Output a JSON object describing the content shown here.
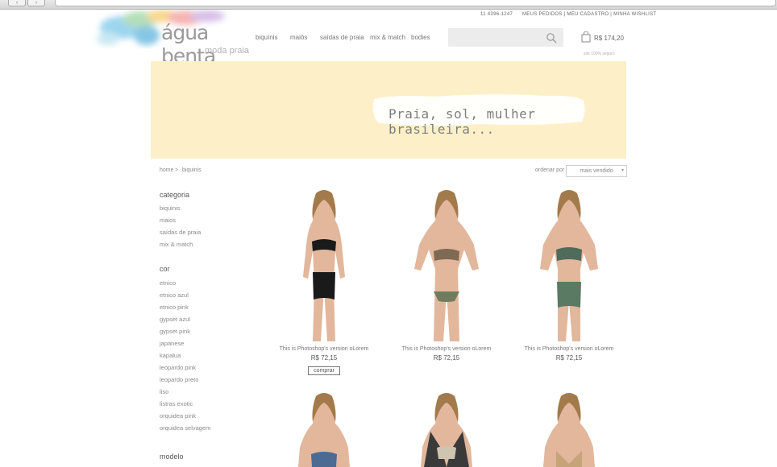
{
  "browser": {
    "back_icon": "chevron-left-icon",
    "forward_icon": "chevron-right-icon"
  },
  "header": {
    "logo_title": "água benta",
    "logo_subtitle": "moda praia",
    "phone": "11 4396-1247",
    "account_links": "MEUS PEDIDOS | MEU CADASTRO | MINHA WISHLIST",
    "menu": [
      "biquínis",
      "maiôs",
      "saídas de praia",
      "mix & match",
      "bodies"
    ],
    "search_placeholder": "",
    "cart_total": "R$ 174,20",
    "secure_note": "site 100% seguro"
  },
  "banner": {
    "text": "Praia, sol, mulher brasileira..."
  },
  "breadcrumb": {
    "home": "home",
    "separator": ">",
    "current": "biquinis"
  },
  "sort": {
    "label": "ordenar por",
    "selected": "mais vendido"
  },
  "sidebar": {
    "categoria_title": "categoria",
    "categoria_items": [
      "biquinis",
      "maios",
      "saídas de praia",
      "mix & match"
    ],
    "cor_title": "cor",
    "cor_items": [
      "etnico",
      "etnico azul",
      "etnico pink",
      "gypset azul",
      "gypset pink",
      "japanese",
      "kapalua",
      "leopardo pink",
      "leopardo preto",
      "liso",
      "listras exotic",
      "orquidea pink",
      "orquidea selvagem"
    ],
    "modelo_title": "modelo"
  },
  "products": [
    {
      "name": "This is Photoshop's version  oLorem",
      "price": "R$ 72,15",
      "buy_label": "comprar"
    },
    {
      "name": "This is Photoshop's version  oLorem",
      "price": "R$ 72,15"
    },
    {
      "name": "This is Photoshop's version  oLorem",
      "price": "R$ 72,15"
    }
  ],
  "colors": {
    "banner_bg": "#fdf0c9",
    "search_bg": "#ececec",
    "text": "#777777"
  }
}
